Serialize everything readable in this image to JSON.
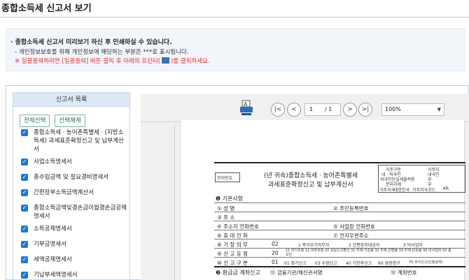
{
  "page": {
    "title": "종합소득세 신고서 보기"
  },
  "notice": {
    "line1": "종합소득세 신고서 미리보기 하신 후 인쇄하실 수 있습니다.",
    "line2": "- 개인정보보호를 위해 개인정보에 해당하는 부분은 ***로 표시됩니다.",
    "line3_pre": "※ 일괄출력하려면 [일괄출력] 버튼 클릭 후 아래의 프린터(",
    "line3_post": ")를 클릭하세요."
  },
  "sidebar": {
    "header": "신고서 목록",
    "select_all": "전체선택",
    "deselect": "선택해제",
    "items": [
      {
        "label": "종합소득세ㆍ농어촌특별세ㆍ(지방소득세) 과세표준확정신고 및 납부계산서",
        "checked": true
      },
      {
        "label": "사업소득명세서",
        "checked": true
      },
      {
        "label": "총수입금액 및 필요경비명세서",
        "checked": true
      },
      {
        "label": "간편장부소득금액계산서",
        "checked": true
      },
      {
        "label": "종합소득금액및결손금이월결손금공제명세서",
        "checked": true
      },
      {
        "label": "소득공제명세서",
        "checked": true
      },
      {
        "label": "기부금명세서",
        "checked": true
      },
      {
        "label": "세액공제명세서",
        "checked": true
      },
      {
        "label": "기납부세액명세서",
        "checked": true
      }
    ]
  },
  "viewer": {
    "page_current": "1",
    "page_total": "/ 1",
    "zoom": "100%",
    "nav": {
      "first": "|<",
      "prev": "<",
      "next": ">",
      "last": ">|"
    }
  },
  "document": {
    "mgmt_no": "관리번호",
    "title1": "(년 귀속)종합소득세ㆍ농어촌특별세",
    "title2": "과세표준확정신고 및 납부계산서",
    "status_labels": [
      "거주구분",
      "거주자",
      "내ㆍ외국인",
      "내국인",
      "외국인단일세율적용",
      "부",
      "분리과세",
      "부",
      "거주지국",
      "대한민국",
      "거주지국코드",
      "KR"
    ],
    "section1": "❶ 기본사항",
    "rows": [
      {
        "num": "①",
        "label": "성     명",
        "num2": "②",
        "label2": "주민등록번호"
      },
      {
        "num": "③",
        "label": "주     소",
        "num2": "",
        "label2": ""
      },
      {
        "num": "④",
        "label": "주소지 전화번호",
        "num2": "⑤",
        "label2": "사업장 전화번호"
      },
      {
        "num": "⑥",
        "label": "휴 대 전 화",
        "num2": "⑦",
        "label2": "전자우편주소"
      },
      {
        "num": "⑧",
        "label": "기 장 의 무",
        "num2": "",
        "label2": ""
      },
      {
        "num": "⑨",
        "label": "신 고 유 형",
        "num2": "",
        "label2": ""
      },
      {
        "num": "⑩",
        "label": "신 고 구 분",
        "num2": "",
        "label2": ""
      }
    ],
    "bookkeeping_value": "02",
    "bookkeeping_opts": [
      "1 복식부기의무자",
      "2 간편장부대상자",
      "3 비사업자"
    ],
    "type_value": "20",
    "type_opts": "11 자기조정  12 외부조정  20 성실신고확인  31 추계-기준율  32 추계-간편율  33 추계-단순율  40 비사업자  50 종교인",
    "class_value": "01",
    "class_opts": [
      "01 정기신고",
      "03 수정신고",
      "40 기한후신고",
      "60 경정청구",
      "70 추가신고(인정상여)"
    ],
    "section2": "❷ 환급금 계좌신고",
    "bank_label": "⑪ 금융기관/체신관서명",
    "account_label": "⑫ 계좌번호"
  }
}
